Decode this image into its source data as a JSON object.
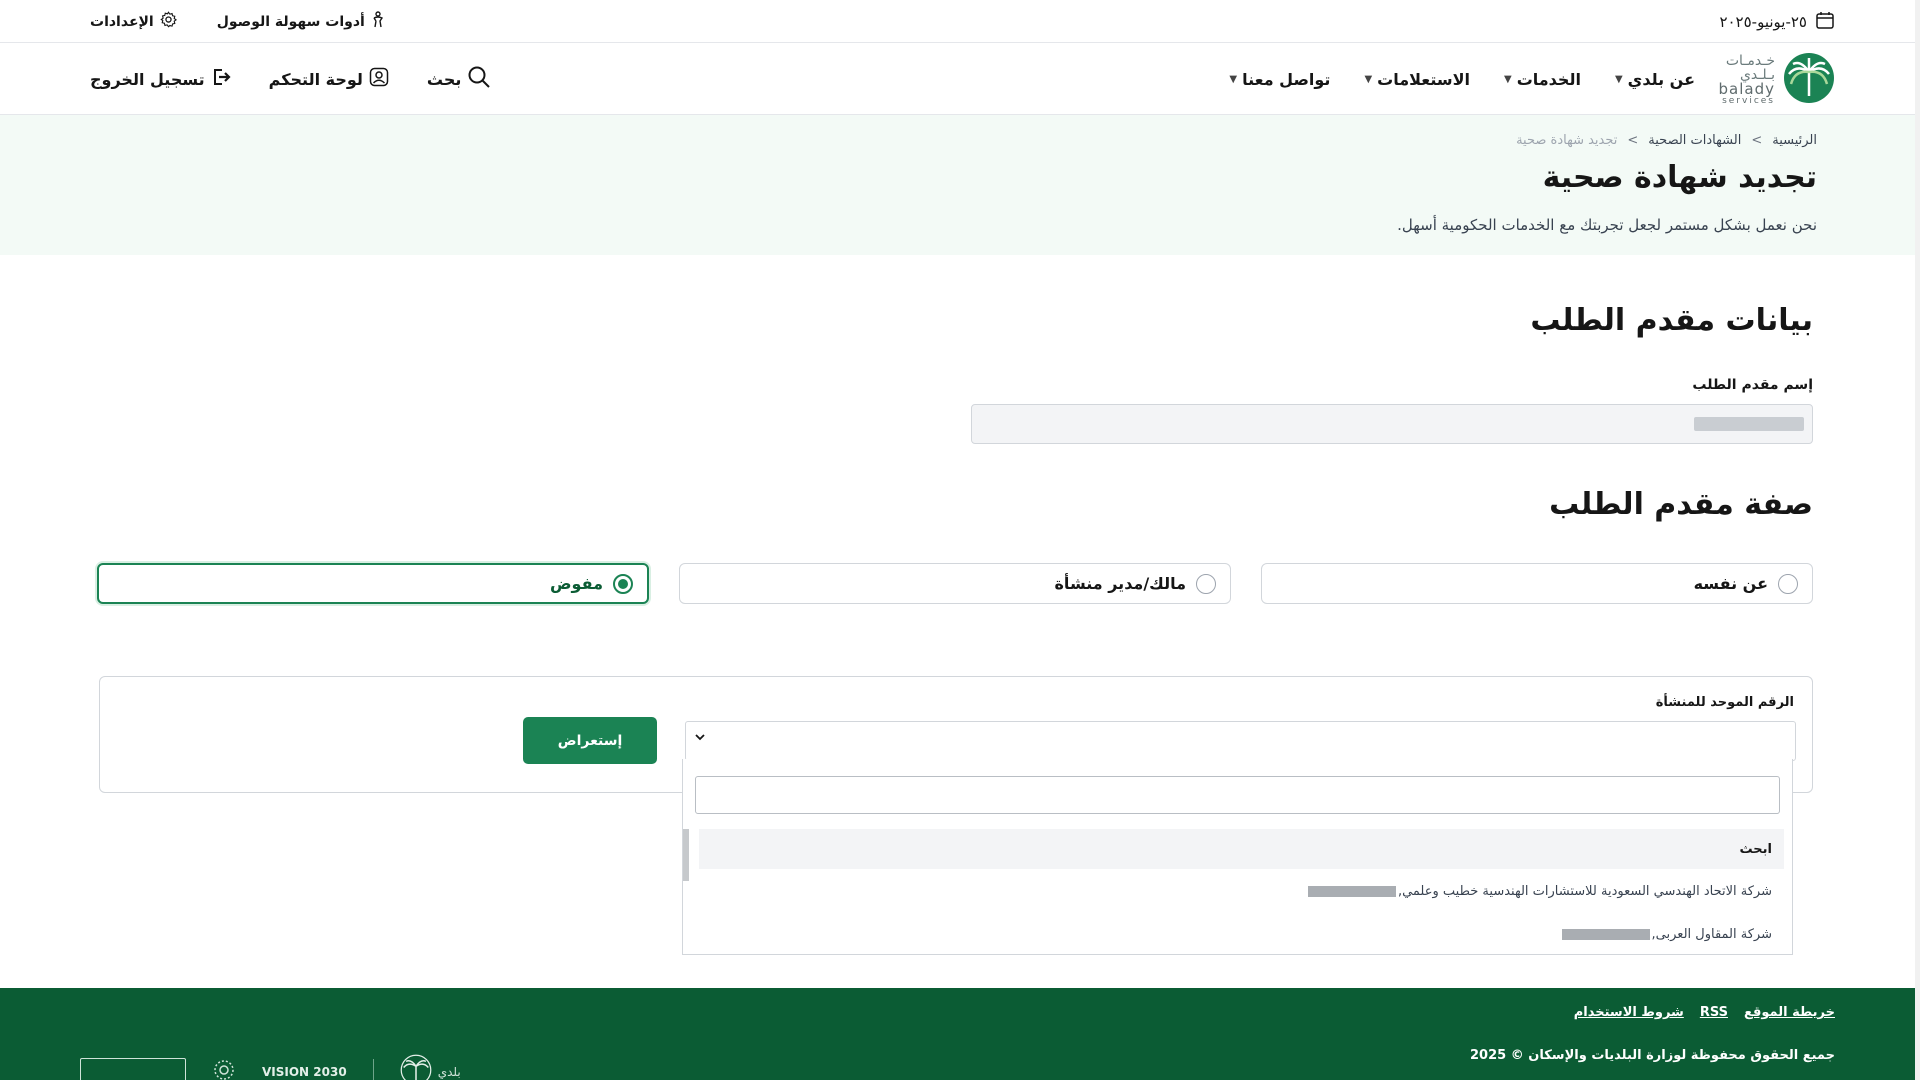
{
  "topbar": {
    "date": "٢٥-يونيو-٢٠٢٥",
    "settings_label": "الإعدادات",
    "accessibility_label": "أدوات سهولة الوصول"
  },
  "nav": {
    "logo": {
      "ar": "خـدمـات بـلـدي",
      "en1": "balady",
      "en2": "services"
    },
    "menu": [
      "عن بلدي",
      "الخدمات",
      "الاستعلامات",
      "تواصل معنا"
    ],
    "search_label": "بحث",
    "dashboard_label": "لوحة التحكم",
    "logout_label": "تسجيل الخروج"
  },
  "hero": {
    "breadcrumb": [
      "الرئيسية",
      "الشهادات الصحية",
      "تجديد شهادة صحية"
    ],
    "title": "تجديد شهادة صحية",
    "subtitle": "نحن نعمل بشكل مستمر لجعل تجربتك مع الخدمات الحكومية أسهل."
  },
  "applicant": {
    "section_title": "بيانات مقدم الطلب",
    "name_label": "إسم مقدم الطلب"
  },
  "capacity": {
    "section_title": "صفة مقدم الطلب",
    "options": [
      "عن نفسه",
      "مالك/مدير منشأة",
      "مفوض"
    ],
    "selected_index": 2
  },
  "establishment": {
    "unified_number_label": "الرقم الموحد للمنشأة",
    "review_button": "إستعراض",
    "dropdown": {
      "search_value": "",
      "header_item": "ابحث",
      "items": [
        "شركة الاتحاد الهندسي السعودية للاستشارات الهندسية خطيب وعلمي,",
        "شركة المقاول العربى,"
      ]
    }
  },
  "footer": {
    "links": [
      "خريطة الموقع",
      "RSS",
      "شروط الاستخدام"
    ],
    "copyright": "جميع الحقوق محفوظة لوزارة البلديات والإسكان © 2025",
    "vision": "VISION 2030",
    "footer_logo_ar": "بلدي"
  },
  "colors": {
    "brand_green": "#1b8354",
    "footer_green": "#0b5c34",
    "hero_bg": "#f3faf6"
  }
}
